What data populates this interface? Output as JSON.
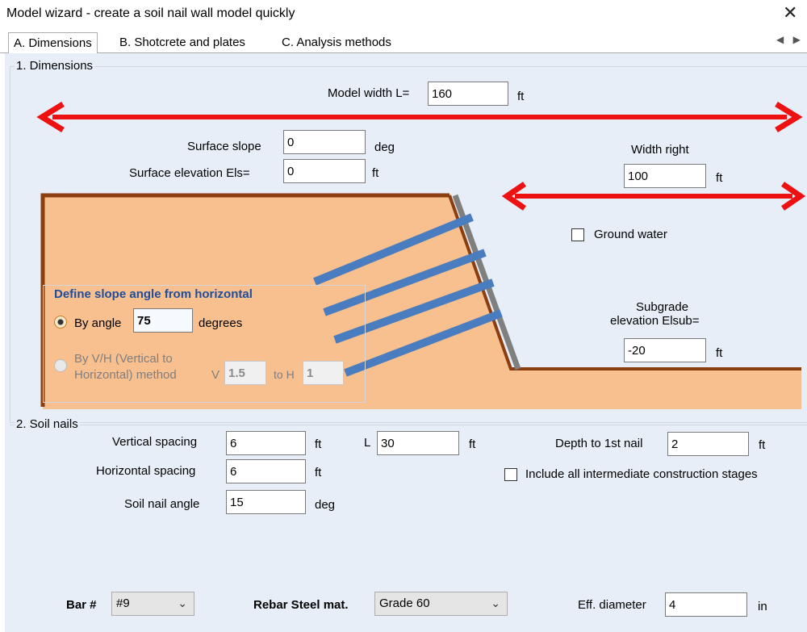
{
  "window": {
    "title": "Model wizard - create a soil nail wall model quickly",
    "close_glyph": "✕"
  },
  "tabs": [
    {
      "label": "A. Dimensions",
      "active": true
    },
    {
      "label": "B. Shotcrete and plates",
      "active": false
    },
    {
      "label": "C. Analysis methods",
      "active": false
    }
  ],
  "tab_scroll_glyph": "◀ ▶",
  "dimensions": {
    "legend": "1. Dimensions",
    "model_width": {
      "label": "Model width L=",
      "value": "160",
      "unit": "ft"
    },
    "surface_slope": {
      "label": "Surface slope",
      "value": "0",
      "unit": "deg"
    },
    "surface_elevation": {
      "label": "Surface elevation Els=",
      "value": "0",
      "unit": "ft"
    },
    "width_right": {
      "label": "Width right",
      "value": "100",
      "unit": "ft"
    },
    "ground_water": {
      "label": "Ground water",
      "checked": false
    },
    "subgrade": {
      "label_line1": "Subgrade",
      "label_line2": "elevation Elsub=",
      "value": "-20",
      "unit": "ft"
    },
    "slope_angle": {
      "title": "Define slope angle from horizontal",
      "by_angle": {
        "label": "By angle",
        "value": "75",
        "unit": "degrees",
        "selected": true
      },
      "by_vh": {
        "label_line1": "By V/H (Vertical to",
        "label_line2": "Horizontal) method",
        "v_label": "V",
        "v_value": "1.5",
        "h_label": "to H",
        "h_value": "1",
        "selected": false
      }
    }
  },
  "soil_nails": {
    "legend": "2. Soil nails",
    "vertical_spacing": {
      "label": "Vertical spacing",
      "value": "6",
      "unit": "ft"
    },
    "length": {
      "label": "L",
      "value": "30",
      "unit": "ft"
    },
    "depth_first_nail": {
      "label": "Depth to 1st nail",
      "value": "2",
      "unit": "ft"
    },
    "horizontal_spacing": {
      "label": "Horizontal spacing",
      "value": "6",
      "unit": "ft"
    },
    "include_stages": {
      "label": "Include all intermediate construction stages",
      "checked": false
    },
    "nail_angle": {
      "label": "Soil nail angle",
      "value": "15",
      "unit": "deg"
    }
  },
  "bottom": {
    "bar": {
      "label": "Bar #",
      "value": "#9"
    },
    "rebar": {
      "label": "Rebar Steel mat.",
      "value": "Grade 60"
    },
    "eff_diameter": {
      "label": "Eff. diameter",
      "value": "4",
      "unit": "in"
    }
  },
  "colors": {
    "arrow": "#ee1111",
    "soil": "#f8bf8f",
    "soil_edge": "#8b3e0f",
    "nail": "#4a7dbf",
    "wall": "#7f7f7f",
    "panel": "#e7eef8",
    "slope_title": "#1f4e9a"
  }
}
